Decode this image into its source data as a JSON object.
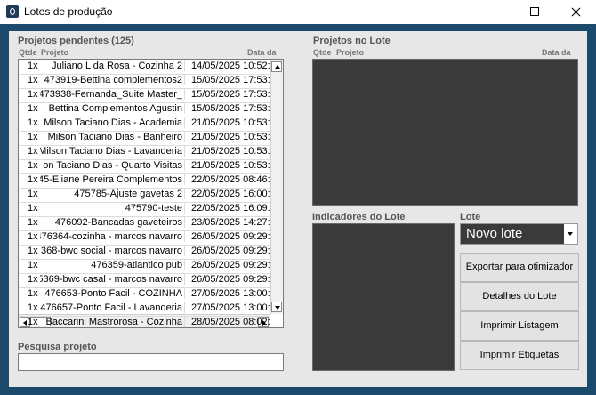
{
  "window": {
    "title": "Lotes de produção"
  },
  "pending": {
    "title": "Projetos pendentes (125)",
    "columns": {
      "qty": "Qtde",
      "project": "Projeto",
      "date": "Data da"
    },
    "rows": [
      {
        "qty": "1x",
        "project": "Juliano L da Rosa - Cozinha 2",
        "date": "14/05/2025 10:52:"
      },
      {
        "qty": "1x",
        "project": "473919-Bettina complementos2",
        "date": "15/05/2025 17:53:"
      },
      {
        "qty": "1x",
        "project": "473938-Fernanda_Suite Master_",
        "date": "15/05/2025 17:53:"
      },
      {
        "qty": "1x",
        "project": "Bettina Complementos Agustin",
        "date": "15/05/2025 17:53:"
      },
      {
        "qty": "1x",
        "project": "Milson Taciano Dias - Academia",
        "date": "21/05/2025 10:53:"
      },
      {
        "qty": "1x",
        "project": "Milson Taciano Dias - Banheiro",
        "date": "21/05/2025 10:53:"
      },
      {
        "qty": "1x",
        "project": "Milson Taciano Dias - Lavanderia",
        "date": "21/05/2025 10:53:"
      },
      {
        "qty": "1x",
        "project": "on Taciano Dias - Quarto Visitas",
        "date": "21/05/2025 10:53:"
      },
      {
        "qty": "1x",
        "project": "45-Eliane Pereira Complementos",
        "date": "22/05/2025 08:46:"
      },
      {
        "qty": "1x",
        "project": "475785-Ajuste gavetas 2",
        "date": "22/05/2025 16:00:"
      },
      {
        "qty": "1x",
        "project": "475790-teste",
        "date": "22/05/2025 16:09:"
      },
      {
        "qty": "1x",
        "project": "476092-Bancadas gaveteiros",
        "date": "23/05/2025 14:27:"
      },
      {
        "qty": "1x",
        "project": "476364-cozinha - marcos navarro",
        "date": "26/05/2025 09:29:"
      },
      {
        "qty": "1x",
        "project": "368-bwc social - marcos navarro",
        "date": "26/05/2025 09:29:"
      },
      {
        "qty": "1x",
        "project": "476359-atlantico pub",
        "date": "26/05/2025 09:29:"
      },
      {
        "qty": "1x",
        "project": "5369-bwc casal - marcos navarro",
        "date": "26/05/2025 09:29:"
      },
      {
        "qty": "1x",
        "project": "476653-Ponto Facil - COZINHA",
        "date": "27/05/2025 13:00:"
      },
      {
        "qty": "1x",
        "project": "476657-Ponto Facil - Lavanderia",
        "date": "27/05/2025 13:00:"
      },
      {
        "qty": "1x",
        "project": "Baccarini Mastrorosa - Cozinha",
        "date": "28/05/2025 08:02:"
      }
    ]
  },
  "search": {
    "label": "Pesquisa projeto",
    "value": ""
  },
  "lot": {
    "title": "Projetos no Lote",
    "columns": {
      "qty": "Qtde",
      "project": "Projeto",
      "date": "Data da"
    },
    "indicators_title": "Indicadores do Lote",
    "lot_label": "Lote",
    "lot_selected": "Novo lote"
  },
  "buttons": {
    "export": "Exportar para otimizador",
    "details": "Detalhes do Lote",
    "print_list": "Imprimir Listagem",
    "print_labels": "Imprimir Etiquetas"
  },
  "colors": {
    "frame": "#1b4a6c",
    "panel": "#3a3a3a",
    "background": "#e7e7e7"
  }
}
